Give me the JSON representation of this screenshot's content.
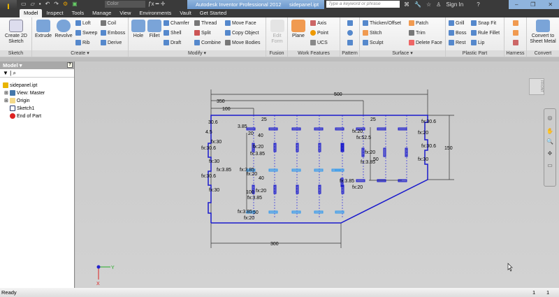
{
  "app": {
    "title": "Autodesk Inventor Professional 2012",
    "document": "sidepanel.ipt",
    "color_select": "Color",
    "search_placeholder": "Type a keyword or phrase",
    "sign_in": "Sign In",
    "app_badge": "PRO"
  },
  "tabs": [
    "Model",
    "Inspect",
    "Tools",
    "Manage",
    "View",
    "Environments",
    "Vault",
    "Get Started"
  ],
  "ribbon": {
    "sketch": {
      "label": "Sketch",
      "create": "Create 2D Sketch"
    },
    "create": {
      "label": "Create",
      "extrude": "Extrude",
      "revolve": "Revolve",
      "loft": "Loft",
      "sweep": "Sweep",
      "rib": "Rib",
      "coil": "Coil",
      "emboss": "Emboss",
      "derive": "Derive"
    },
    "modify": {
      "label": "Modify",
      "hole": "Hole",
      "fillet": "Fillet",
      "chamfer": "Chamfer",
      "shell": "Shell",
      "draft": "Draft",
      "thread": "Thread",
      "split": "Split",
      "combine": "Combine",
      "move_face": "Move Face",
      "copy_object": "Copy Object",
      "move_bodies": "Move Bodies"
    },
    "fusion": {
      "label": "Fusion",
      "edit_form": "Edit Form"
    },
    "work": {
      "label": "Work Features",
      "plane": "Plane",
      "axis": "Axis",
      "point": "Point",
      "ucs": "UCS"
    },
    "pattern": {
      "label": "Pattern"
    },
    "surface": {
      "label": "Surface",
      "thicken": "Thicken/Offset",
      "stitch": "Stitch",
      "sculpt": "Sculpt",
      "patch": "Patch",
      "trim": "Trim",
      "delete_face": "Delete Face"
    },
    "plastic": {
      "label": "Plastic Part",
      "grill": "Grill",
      "boss": "Boss",
      "rest": "Rest",
      "snap_fit": "Snap Fit",
      "rule_fillet": "Rule Fillet",
      "lip": "Lip"
    },
    "harness": {
      "label": "Harness"
    },
    "convert": {
      "label": "Convert",
      "sheet_metal": "Convert to Sheet Metal"
    }
  },
  "browser": {
    "title": "Model",
    "items": [
      "sidepanel.ipt",
      "View: Master",
      "Origin",
      "Sketch1",
      "End of Part"
    ]
  },
  "sketch": {
    "dims": {
      "d500": "500",
      "d350": "350",
      "d100": "100",
      "d300": "300",
      "d150": "150",
      "d25a": "25",
      "d25b": "25",
      "d40a": "40",
      "d40b": "40",
      "d100b": "100",
      "d50": "50",
      "d50b": "50",
      "d3a": "3.85",
      "d30_6": "30.6",
      "d4": "4.5",
      "fx20a": "20",
      "fx30a": "fx:30",
      "fx306a": "fx:30.6",
      "fx30b": "fx:30",
      "fx306b": "fx:30.6",
      "fx30c": "fx:30",
      "fx385a": "fx:3.85",
      "fx20b": "fx:20",
      "fx20c": "fx:20",
      "fx385b": "fx:3.85",
      "fx385c": "fx:3.85",
      "fx20d": "fx:20",
      "fx385d": "fx:3.85",
      "fx20e": "fx:20",
      "fx385e": "fx:3.85",
      "fx20f": "fx:20",
      "fx525": "fx:52.5",
      "fx20g": "fx:20",
      "fx385f": "fx:3.85",
      "fx385g": "fx:3.85",
      "fx20h": "fx:20",
      "fxr306a": "fx:30.6",
      "fxr20": "fx:20",
      "fxr306b": "fx:30.6",
      "fxr30": "fx:30"
    },
    "axis": {
      "x": "X",
      "y": "Y"
    },
    "viewcube": "FRONT"
  },
  "status": {
    "text": "Ready",
    "count1": "1",
    "count2": "1"
  },
  "colors": {
    "sketch_line": "#1a1acc",
    "highlight": "#3399ee",
    "title_blue": "#7aa3d4"
  }
}
